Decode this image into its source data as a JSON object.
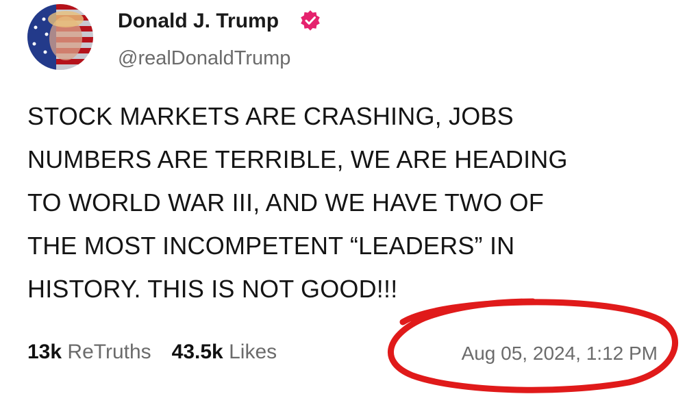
{
  "author": {
    "display_name": "Donald J. Trump",
    "handle": "@realDonaldTrump",
    "avatar_icon": "avatar-flag-portrait-icon",
    "verified_icon": "verified-badge-icon",
    "verified_color": "#e5226d"
  },
  "post": {
    "text": "STOCK MARKETS ARE CRASHING, JOBS\nNUMBERS ARE TERRIBLE, WE ARE HEADING\nTO WORLD WAR III, AND WE HAVE TWO OF\nTHE MOST INCOMPETENT “LEADERS” IN\nHISTORY. THIS IS NOT GOOD!!!"
  },
  "stats": {
    "retruths_count": "13k",
    "retruths_label": "ReTruths",
    "likes_count": "43.5k",
    "likes_label": "Likes"
  },
  "timestamp": "Aug 05, 2024, 1:12 PM",
  "annotation": {
    "shape": "hand-drawn circle",
    "color": "#e01a1a"
  }
}
